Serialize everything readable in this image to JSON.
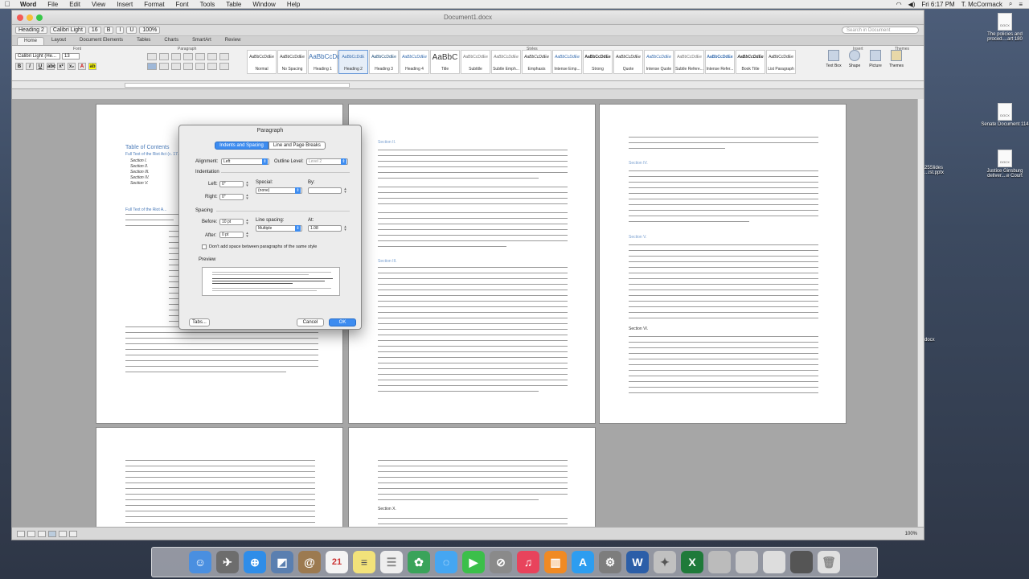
{
  "menubar": {
    "app": "Word",
    "items": [
      "File",
      "Edit",
      "View",
      "Insert",
      "Format",
      "Font",
      "Tools",
      "Table",
      "Window",
      "Help"
    ],
    "clock": "Fri 6:17 PM",
    "user": "T. McCormack"
  },
  "window": {
    "title": "Document1.docx",
    "zoom": "100%",
    "search_placeholder": "Search in Document",
    "style_box": "Heading 2",
    "font_box": "Calibri Light",
    "size_box": "16"
  },
  "ribbon": {
    "tabs": [
      "Home",
      "Layout",
      "Document Elements",
      "Tables",
      "Charts",
      "SmartArt",
      "Review"
    ],
    "groups": {
      "font": "Font",
      "paragraph": "Paragraph",
      "styles": "Styles",
      "insert": "Insert",
      "themes": "Themes"
    },
    "font_name": "Calibri Light (He...",
    "font_size": "13",
    "styles": [
      {
        "preview": "AaBbCcDdEe",
        "name": "Normal"
      },
      {
        "preview": "AaBbCcDdEe",
        "name": "No Spacing"
      },
      {
        "preview": "AaBbCcDc",
        "name": "Heading 1"
      },
      {
        "preview": "AaBbCcDdE",
        "name": "Heading 2"
      },
      {
        "preview": "AaBbCcDdEe",
        "name": "Heading 3"
      },
      {
        "preview": "AaBbCcDdEe",
        "name": "Heading 4"
      },
      {
        "preview": "AaBbC",
        "name": "Title"
      },
      {
        "preview": "AaBbCcDdEe",
        "name": "Subtitle"
      },
      {
        "preview": "AaBbCcDdEe",
        "name": "Subtle Emph..."
      },
      {
        "preview": "AaBbCcDdEe",
        "name": "Emphasis"
      },
      {
        "preview": "AaBbCcDdEe",
        "name": "Intense Emp..."
      },
      {
        "preview": "AaBbCcDdEe",
        "name": "Strong"
      },
      {
        "preview": "AaBbCcDdEe",
        "name": "Quote"
      },
      {
        "preview": "AaBbCcDdEe",
        "name": "Intense Quote"
      },
      {
        "preview": "AaBbCcDdEe",
        "name": "Subtle Refere..."
      },
      {
        "preview": "AaBbCcDdEe",
        "name": "Intense Refer..."
      },
      {
        "preview": "AaBbCcDdEe",
        "name": "Book Title"
      },
      {
        "preview": "AaBbCcDdEe",
        "name": "List Paragraph"
      }
    ],
    "insert_items": [
      "Text Box",
      "Shape",
      "Picture",
      "Themes"
    ]
  },
  "document": {
    "toc_title": "Table of Contents",
    "toc_sub": "Full Text of the Riot Act (c. 17...",
    "toc_items": [
      "Section I.",
      "Section II.",
      "Section III.",
      "Section IV.",
      "Section V."
    ],
    "full_text_heading": "Full Text of the Riot A...",
    "page2_section": "Section II.",
    "page2_section_b": "Section III.",
    "page3_section_a": "Section IV.",
    "page3_section_b": "Section V.",
    "page3_section_c": "Section VI.",
    "page5_section": "Section X."
  },
  "dialog": {
    "title": "Paragraph",
    "tabs": [
      "Indents and Spacing",
      "Line and Page Breaks"
    ],
    "alignment_label": "Alignment:",
    "alignment_value": "Left",
    "outline_label": "Outline Level:",
    "outline_value": "Level 2",
    "indentation_label": "Indentation",
    "left_label": "Left:",
    "left_value": "0\"",
    "right_label": "Right:",
    "right_value": "0\"",
    "special_label": "Special:",
    "special_value": "(none)",
    "by_label": "By:",
    "spacing_label": "Spacing",
    "before_label": "Before:",
    "before_value": "10 pt",
    "after_label": "After:",
    "after_value": "0 pt",
    "line_spacing_label": "Line spacing:",
    "line_spacing_value": "Multiple",
    "at_label": "At:",
    "at_value": "1.08",
    "dont_add_label": "Don't add space between paragraphs of the same style",
    "preview_label": "Preview",
    "tabs_button": "Tabs...",
    "cancel_button": "Cancel",
    "ok_button": "OK"
  },
  "desktop": {
    "icons": [
      {
        "name": "The policies and proced....art 180",
        "ext": "DOCX"
      },
      {
        "name": "Senate Document 114",
        "ext": "DOCX"
      },
      {
        "name": "Justice Ginsburg deliver....e Court",
        "ext": "DOCX"
      }
    ],
    "partial_labels": [
      "25Slides ...ist.pptx",
      "docx"
    ]
  },
  "status": {
    "zoom": "100%"
  },
  "colors": {
    "accent": "#3d8cf0",
    "heading": "#4a7ab8"
  }
}
